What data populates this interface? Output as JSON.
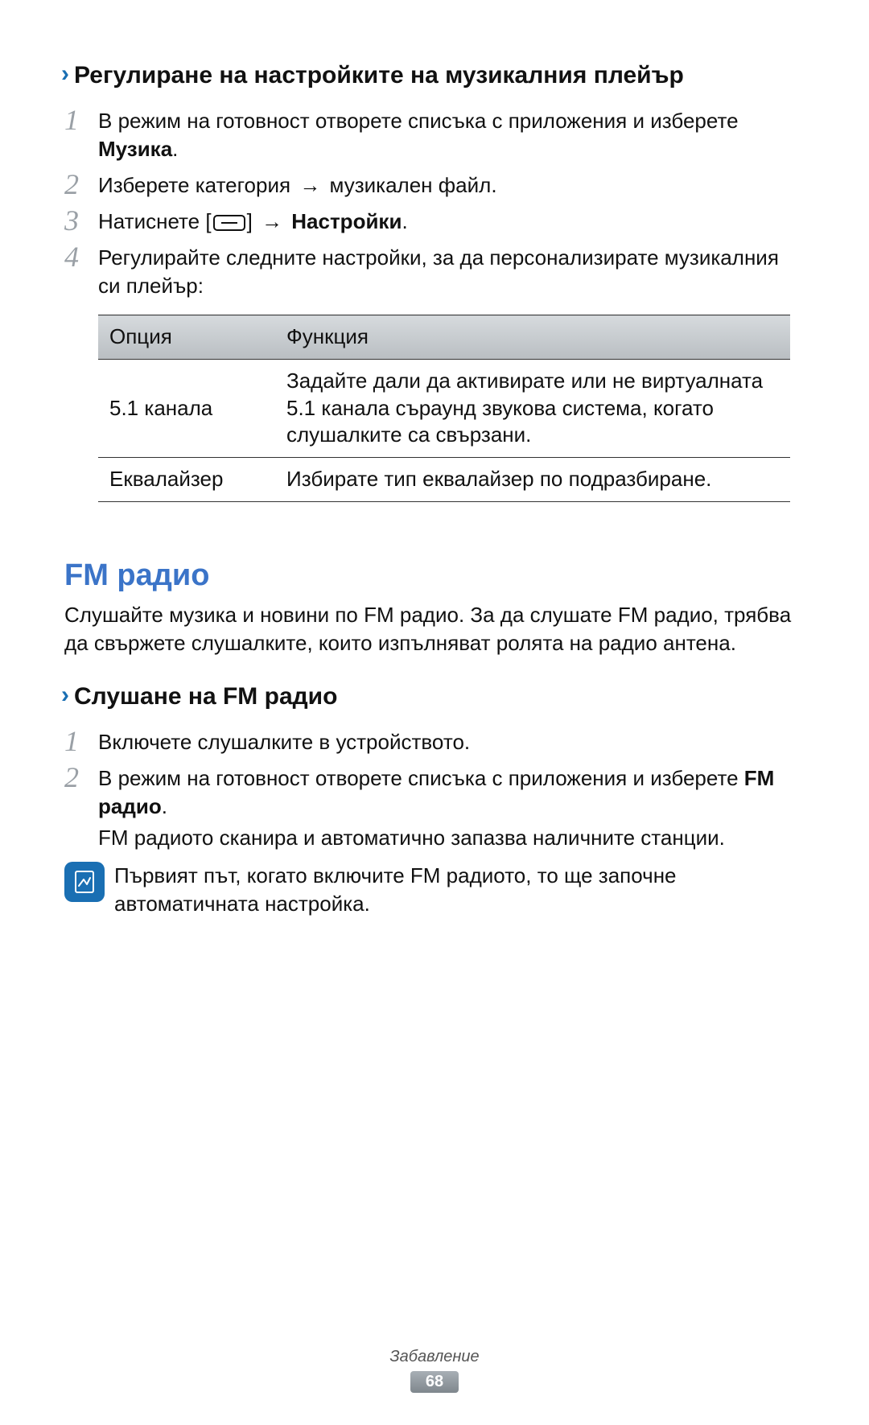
{
  "section1": {
    "heading": "Регулиране на настройките на музикалния плейър",
    "steps": [
      {
        "num": "1",
        "prefix": "В режим на готовност отворете списъка с приложения и изберете ",
        "bold": "Музика",
        "suffix": "."
      },
      {
        "num": "2",
        "prefix": "Изберете категория ",
        "arrow": "→",
        "suffix": " музикален файл."
      },
      {
        "num": "3",
        "prefix": "Натиснете [",
        "suffix_before_arrow": "] ",
        "arrow": "→",
        "bold": " Настройки",
        "suffix": "."
      },
      {
        "num": "4",
        "prefix": "Регулирайте следните настройки, за да персонализирате музикалния си плейър:"
      }
    ],
    "table": {
      "head": {
        "c1": "Опция",
        "c2": "Функция"
      },
      "rows": [
        {
          "c1": "5.1 канала",
          "c2": "Задайте дали да активирате или не виртуалната 5.1 канала съраунд звукова система, когато слушалките са свързани."
        },
        {
          "c1": "Еквалайзер",
          "c2": "Избирате тип еквалайзер по подразбиране."
        }
      ]
    }
  },
  "section2": {
    "title": "FM радио",
    "intro": "Слушайте музика и новини по FM радио. За да слушате FM радио, трябва да свържете слушалките, които изпълняват ролята на радио антена.",
    "subheading": "Слушане на FM радио",
    "steps": [
      {
        "num": "1",
        "prefix": "Включете слушалките в устройството."
      },
      {
        "num": "2",
        "prefix": "В режим на готовност отворете списъка с приложения и изберете ",
        "bold": "FM радио",
        "suffix": ".",
        "extra": "FM радиото сканира и автоматично запазва наличните станции."
      }
    ],
    "note": "Първият път, когато включите FM радиото, то ще започне автоматичната настройка."
  },
  "footer": {
    "chapter": "Забавление",
    "page": "68"
  },
  "icons": {
    "chevron": "›",
    "arrow": "→"
  }
}
